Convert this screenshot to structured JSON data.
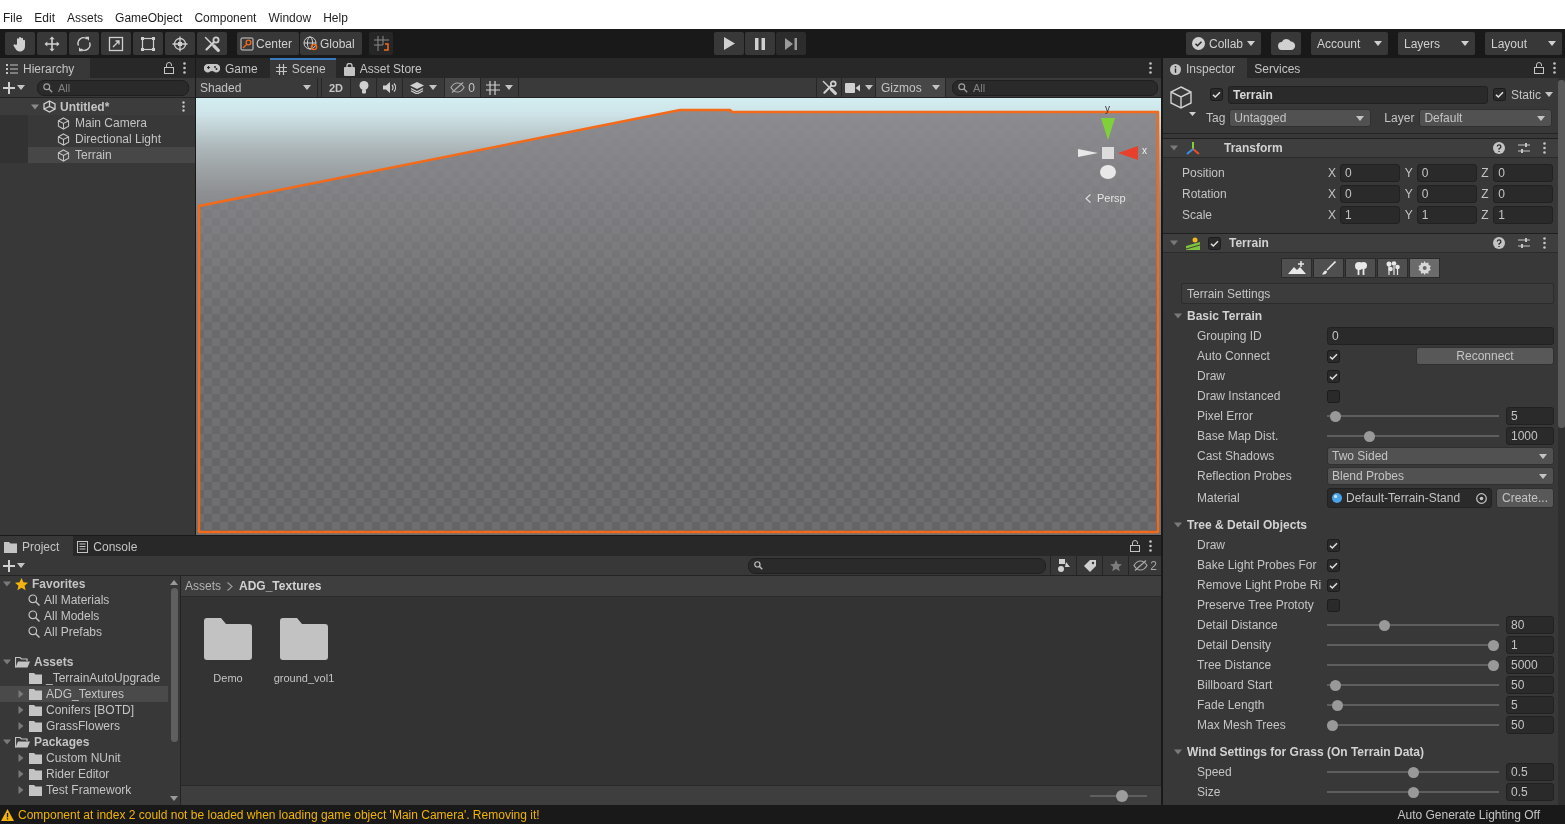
{
  "menu_bar": {
    "items": [
      "File",
      "Edit",
      "Assets",
      "GameObject",
      "Component",
      "Window",
      "Help"
    ]
  },
  "toolbar": {
    "pivot": [
      {
        "kind": "center",
        "label": "Center"
      },
      {
        "kind": "global",
        "label": "Global"
      }
    ],
    "collab": "Collab",
    "menus": [
      "Account",
      "Layers",
      "Layout"
    ]
  },
  "hierarchy": {
    "tab": "Hierarchy",
    "search": {
      "placeholder": "All"
    },
    "scene": {
      "name": "Untitled*",
      "expanded": true,
      "children": [
        {
          "name": "Main Camera",
          "selected": false
        },
        {
          "name": "Directional Light",
          "selected": false
        },
        {
          "name": "Terrain",
          "selected": true
        }
      ]
    }
  },
  "scene_view": {
    "tabs": [
      {
        "kind": "game",
        "label": "Game",
        "selected": false
      },
      {
        "kind": "scene",
        "label": "Scene",
        "selected": true
      },
      {
        "kind": "store",
        "label": "Asset Store",
        "selected": false
      }
    ],
    "shading": "Shaded",
    "mode_2d": "2D",
    "hidden_count": "0",
    "gizmos": "Gizmos",
    "search": {
      "placeholder": "All"
    },
    "gizmo_axes": [
      "y",
      "x"
    ],
    "projection": "Persp"
  },
  "project": {
    "tabs": [
      {
        "kind": "project",
        "label": "Project",
        "selected": true
      },
      {
        "kind": "console",
        "label": "Console",
        "selected": false
      }
    ],
    "hidden_count": "2",
    "tree": [
      {
        "kind": "favorites",
        "label": "Favorites",
        "expanded": true,
        "selected": false,
        "children": [
          {
            "kind": "search",
            "label": "All Materials",
            "selected": false
          },
          {
            "kind": "search",
            "label": "All Models",
            "selected": false
          },
          {
            "kind": "search",
            "label": "All Prefabs",
            "selected": false
          }
        ]
      },
      {
        "kind": "root",
        "label": "Assets",
        "expanded": true,
        "selected": false,
        "children": [
          {
            "kind": "leaf",
            "label": "_TerrainAutoUpgrade",
            "selected": false
          },
          {
            "kind": "folder",
            "label": "ADG_Textures",
            "selected": true
          },
          {
            "kind": "folder",
            "label": "Conifers [BOTD]",
            "selected": false
          },
          {
            "kind": "folder",
            "label": "GrassFlowers",
            "selected": false
          }
        ]
      },
      {
        "kind": "root",
        "label": "Packages",
        "expanded": true,
        "selected": false,
        "children": [
          {
            "kind": "folder",
            "label": "Custom NUnit",
            "selected": false
          },
          {
            "kind": "folder",
            "label": "Rider Editor",
            "selected": false
          },
          {
            "kind": "folder",
            "label": "Test Framework",
            "selected": false
          }
        ]
      }
    ],
    "breadcrumb": [
      "Assets",
      "ADG_Textures"
    ],
    "items": [
      {
        "name": "Demo",
        "selected": false
      },
      {
        "name": "ground_vol1",
        "selected": false
      }
    ],
    "icon_size": {
      "level": 0.58
    }
  },
  "inspector": {
    "tabs": [
      {
        "kind": "inspector",
        "label": "Inspector",
        "selected": true
      },
      {
        "kind": "services",
        "label": "Services",
        "selected": false
      }
    ],
    "object": {
      "active": true,
      "name": "Terrain",
      "static": true,
      "static_label": "Static",
      "tag_label": "Tag",
      "tag": "Untagged",
      "layer_label": "Layer",
      "layer": "Default"
    },
    "transform": {
      "title": "Transform",
      "expanded": true,
      "rows": [
        {
          "label": "Position",
          "fields": [
            {
              "axis": "X",
              "value": "0"
            },
            {
              "axis": "Y",
              "value": "0"
            },
            {
              "axis": "Z",
              "value": "0"
            }
          ]
        },
        {
          "label": "Rotation",
          "fields": [
            {
              "axis": "X",
              "value": "0"
            },
            {
              "axis": "Y",
              "value": "0"
            },
            {
              "axis": "Z",
              "value": "0"
            }
          ]
        },
        {
          "label": "Scale",
          "fields": [
            {
              "axis": "X",
              "value": "1"
            },
            {
              "axis": "Y",
              "value": "1"
            },
            {
              "axis": "Z",
              "value": "1"
            }
          ]
        }
      ]
    },
    "terrain": {
      "title": "Terrain",
      "enabled": true,
      "expanded": true,
      "tools": [
        {
          "kind": "raise",
          "selected": false
        },
        {
          "kind": "paint",
          "selected": false
        },
        {
          "kind": "trees",
          "selected": false
        },
        {
          "kind": "details",
          "selected": false
        },
        {
          "kind": "settings",
          "selected": true
        }
      ],
      "mode_title": "Terrain Settings",
      "sections": [
        {
          "title": "Basic Terrain",
          "expanded": true,
          "rows": [
            {
              "kind": "text",
              "label": "Grouping ID",
              "value": "0"
            },
            {
              "kind": "checkbox",
              "label": "Auto Connect",
              "checked": true,
              "button": "Reconnect"
            },
            {
              "kind": "checkbox",
              "label": "Draw",
              "checked": true
            },
            {
              "kind": "checkbox",
              "label": "Draw Instanced",
              "checked": false
            },
            {
              "kind": "slider",
              "label": "Pixel Error",
              "level": 0.02,
              "value": "5"
            },
            {
              "kind": "slider",
              "label": "Base Map Dist.",
              "level": 0.23,
              "value": "1000"
            },
            {
              "kind": "dropdown",
              "label": "Cast Shadows",
              "value": "Two Sided"
            },
            {
              "kind": "dropdown",
              "label": "Reflection Probes",
              "value": "Blend Probes"
            },
            {
              "kind": "object",
              "label": "Material",
              "value": "Default-Terrain-Stand",
              "button": "Create..."
            }
          ]
        },
        {
          "title": "Tree & Detail Objects",
          "expanded": true,
          "rows": [
            {
              "kind": "checkbox",
              "label": "Draw",
              "checked": true
            },
            {
              "kind": "checkbox",
              "label": "Bake Light Probes For",
              "checked": true
            },
            {
              "kind": "checkbox",
              "label": "Remove Light Probe Ri",
              "checked": true
            },
            {
              "kind": "checkbox",
              "label": "Preserve Tree Prototy",
              "checked": false
            },
            {
              "kind": "slider",
              "label": "Detail Distance",
              "level": 0.32,
              "value": "80"
            },
            {
              "kind": "slider",
              "label": "Detail Density",
              "level": 1,
              "value": "1"
            },
            {
              "kind": "slider",
              "label": "Tree Distance",
              "level": 1,
              "value": "5000"
            },
            {
              "kind": "slider",
              "label": "Billboard Start",
              "level": 0.02,
              "value": "50"
            },
            {
              "kind": "slider",
              "label": "Fade Length",
              "level": 0.03,
              "value": "5"
            },
            {
              "kind": "slider",
              "label": "Max Mesh Trees",
              "level": 0,
              "value": "50"
            }
          ]
        },
        {
          "title": "Wind Settings for Grass (On Terrain Data)",
          "expanded": true,
          "rows": [
            {
              "kind": "slider",
              "label": "Speed",
              "level": 0.5,
              "value": "0.5"
            },
            {
              "kind": "slider",
              "label": "Size",
              "level": 0.5,
              "value": "0.5"
            }
          ]
        }
      ]
    }
  },
  "status_bar": {
    "message": "Component at index 2 could not be loaded when loading game object 'Main Camera'. Removing it!",
    "lighting": "Auto Generate Lighting Off"
  }
}
